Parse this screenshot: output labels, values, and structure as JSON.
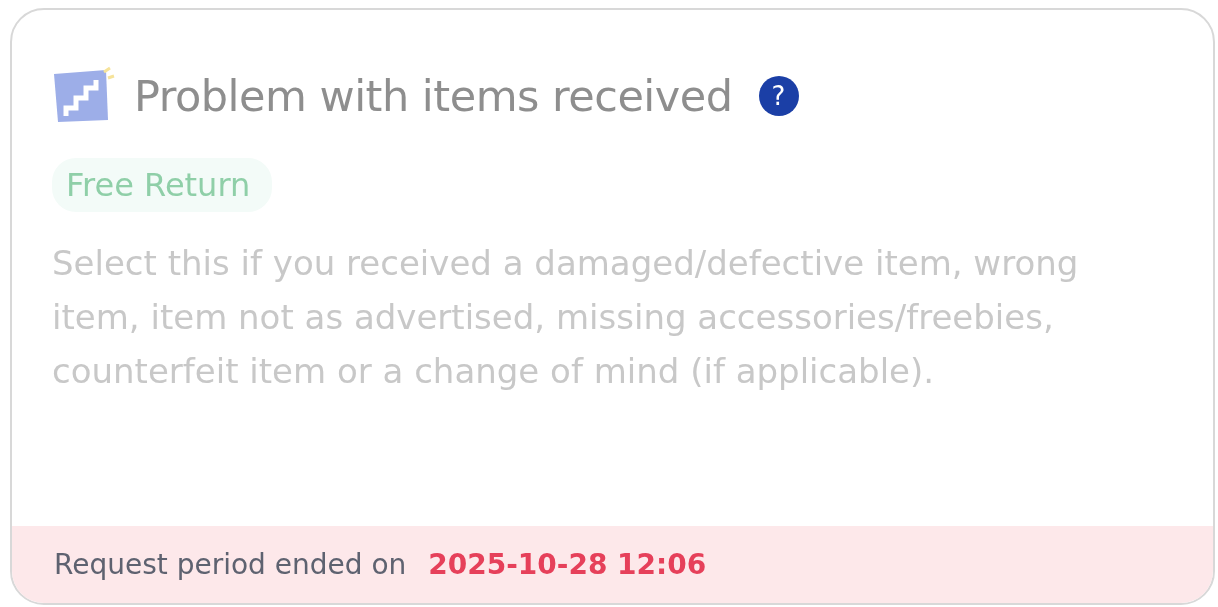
{
  "option": {
    "title": "Problem with items received",
    "help": "?",
    "tag": "Free Return",
    "description": "Select this if you received a damaged/defective item, wrong item, item not as advertised, missing accessories/freebies, counterfeit item or a change of mind (if applicable).",
    "footer": {
      "label": "Request period ended on",
      "date": "2025-10-28 12:06"
    }
  }
}
